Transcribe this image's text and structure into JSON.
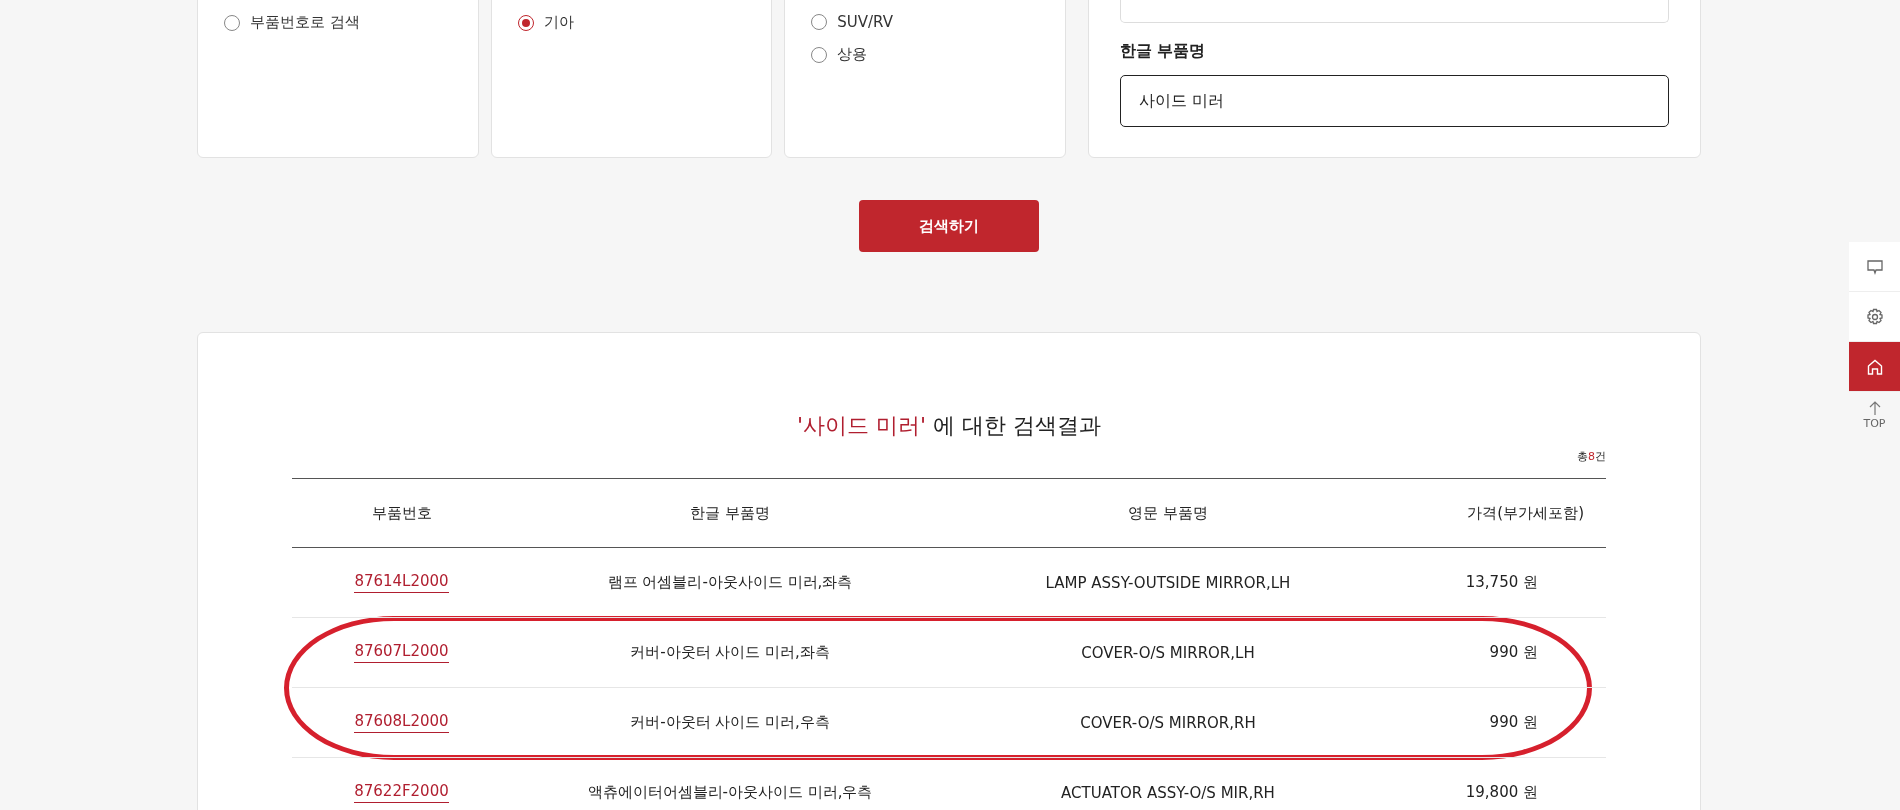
{
  "filters": [
    {
      "options": [
        {
          "label": "부품번호로 검색",
          "selected": false
        }
      ]
    },
    {
      "options": [
        {
          "label": "기아",
          "selected": true
        }
      ]
    },
    {
      "options": [
        {
          "label": "SUV/RV",
          "selected": false
        },
        {
          "label": "상용",
          "selected": false
        }
      ]
    }
  ],
  "name_field": {
    "label": "한글 부품명",
    "value": "사이드 미러"
  },
  "search_button": "검색하기",
  "results": {
    "query": "'사이드 미러'",
    "title_rest": " 에 대한 검색결과",
    "total_prefix": "총",
    "total": "8",
    "total_suffix": "건",
    "columns": [
      "부품번호",
      "한글 부품명",
      "영문 부품명",
      "가격(부가세포함)"
    ],
    "rows": [
      {
        "part_no": "87614L2000",
        "name_ko": "램프 어셈블리-아웃사이드 미러,좌측",
        "name_en": "LAMP ASSY-OUTSIDE MIRROR,LH",
        "price": "13,750 원",
        "circled": false
      },
      {
        "part_no": "87607L2000",
        "name_ko": "커버-아웃터 사이드 미러,좌측",
        "name_en": "COVER-O/S MIRROR,LH",
        "price": "990 원",
        "circled": true
      },
      {
        "part_no": "87608L2000",
        "name_ko": "커버-아웃터 사이드 미러,우측",
        "name_en": "COVER-O/S MIRROR,RH",
        "price": "990 원",
        "circled": true
      },
      {
        "part_no": "87622F2000",
        "name_ko": "액츄에이터어셈블리-아웃사이드 미러,우측",
        "name_en": "ACTUATOR ASSY-O/S MIR,RH",
        "price": "19,800 원",
        "circled": false
      }
    ]
  },
  "side_buttons": [
    {
      "kind": "chat",
      "selected": false
    },
    {
      "kind": "settings",
      "selected": false
    },
    {
      "kind": "home",
      "selected": true
    }
  ],
  "top_link": "TOP"
}
